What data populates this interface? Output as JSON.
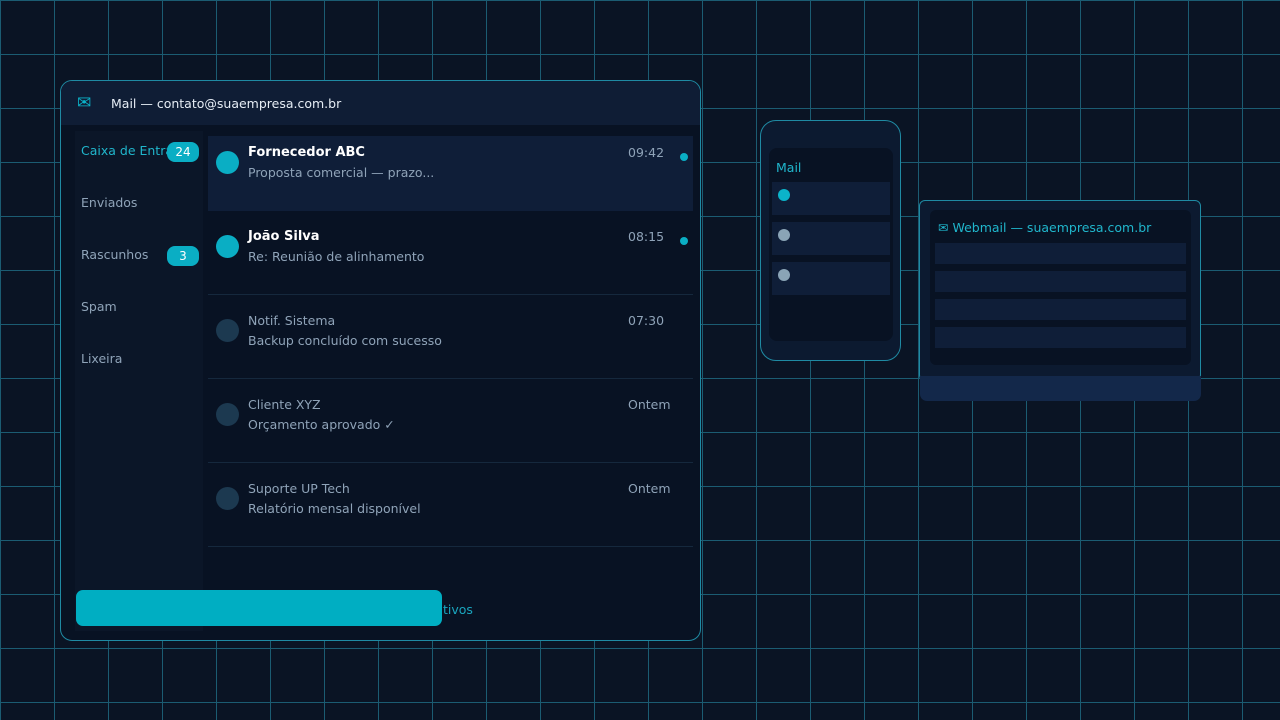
{
  "mail_window": {
    "title_icon": "✉",
    "title": "Mail — contato@suaempresa.com.br"
  },
  "sidebar": {
    "folders": [
      {
        "label": "Caixa de Entrada",
        "badge": "24",
        "active": true
      },
      {
        "label": "Enviados",
        "badge": null,
        "active": false
      },
      {
        "label": "Rascunhos",
        "badge": "3",
        "active": false
      },
      {
        "label": "Spam",
        "badge": null,
        "active": false
      },
      {
        "label": "Lixeira",
        "badge": null,
        "active": false
      }
    ]
  },
  "emails": [
    {
      "sender": "Fornecedor ABC",
      "subject": "Proposta comercial — prazo...",
      "time": "09:42",
      "unread": true
    },
    {
      "sender": "João Silva",
      "subject": "Re: Reunião de alinhamento",
      "time": "08:15",
      "unread": true
    },
    {
      "sender": "Notif. Sistema",
      "subject": "Backup concluído com sucesso",
      "time": "07:30",
      "unread": false
    },
    {
      "sender": "Cliente XYZ",
      "subject": "Orçamento aprovado ✓",
      "time": "Ontem",
      "unread": false
    },
    {
      "sender": "Suporte UP Tech",
      "subject": "Relatório mensal disponível",
      "time": "Ontem",
      "unread": false
    }
  ],
  "bottom": {
    "text": "tivos"
  },
  "phone": {
    "title": "Mail"
  },
  "laptop": {
    "title": "✉ Webmail — suaempresa.com.br"
  },
  "colors": {
    "accent": "#0aaec4",
    "background": "#0a1424",
    "grid": "#1b5c72",
    "panel": "#081223",
    "selected_row": "#0f1e38"
  }
}
